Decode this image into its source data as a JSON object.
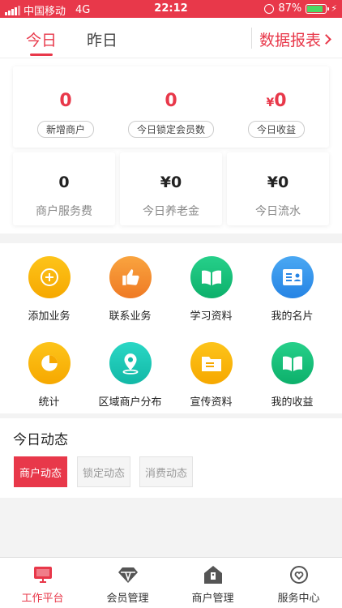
{
  "status_bar": {
    "carrier": "中国移动",
    "network": "4G",
    "time": "22:12",
    "battery": "87%",
    "battery_level": 0.87
  },
  "tabs": [
    {
      "label": "今日",
      "active": true
    },
    {
      "label": "昨日",
      "active": false
    }
  ],
  "report_link": "数据报表",
  "stats_top": [
    {
      "value": "0",
      "label": "新增商户"
    },
    {
      "value": "0",
      "label": "今日锁定会员数"
    },
    {
      "currency": "¥",
      "value": "0",
      "label": "今日收益"
    }
  ],
  "stats_bottom": [
    {
      "value": "0",
      "label": "商户服务费"
    },
    {
      "value": "¥0",
      "label": "今日养老金"
    },
    {
      "value": "¥0",
      "label": "今日流水"
    }
  ],
  "features": [
    {
      "label": "添加业务",
      "icon": "plus-icon"
    },
    {
      "label": "联系业务",
      "icon": "thumbs-up-icon"
    },
    {
      "label": "学习资料",
      "icon": "book-icon"
    },
    {
      "label": "我的名片",
      "icon": "contact-card-icon"
    },
    {
      "label": "统计",
      "icon": "pie-chart-icon"
    },
    {
      "label": "区域商户分布",
      "icon": "location-pin-icon"
    },
    {
      "label": "宣传资料",
      "icon": "folder-icon"
    },
    {
      "label": "我的收益",
      "icon": "book-icon"
    }
  ],
  "dynamics": {
    "title": "今日动态",
    "buttons": [
      {
        "label": "商户动态",
        "active": true
      },
      {
        "label": "锁定动态",
        "active": false
      },
      {
        "label": "消费动态",
        "active": false
      }
    ]
  },
  "bottom_nav": [
    {
      "label": "工作平台",
      "icon": "monitor-icon",
      "active": true
    },
    {
      "label": "会员管理",
      "icon": "diamond-icon",
      "active": false
    },
    {
      "label": "商户管理",
      "icon": "store-icon",
      "active": false
    },
    {
      "label": "服务中心",
      "icon": "heart-icon",
      "active": false
    }
  ],
  "colors": {
    "accent": "#e8384a",
    "success": "#4cd964"
  }
}
